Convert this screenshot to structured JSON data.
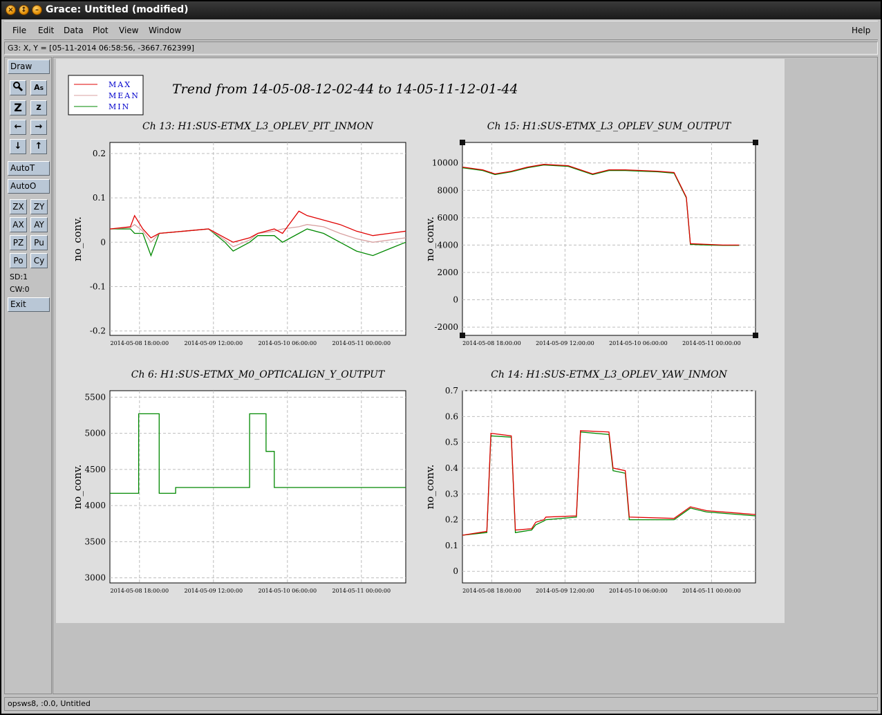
{
  "window": {
    "title": "Grace: Untitled (modified)"
  },
  "menubar": {
    "items": [
      "File",
      "Edit",
      "Data",
      "Plot",
      "View",
      "Window"
    ],
    "help": "Help"
  },
  "locator": {
    "text": "G3: X, Y = [05-11-2014 06:58:56, -3667.762399]"
  },
  "toolbar": {
    "draw": "Draw",
    "autot": "AutoT",
    "autoo": "AutoO",
    "zx": "ZX",
    "zy": "ZY",
    "ax": "AX",
    "ay": "AY",
    "pz": "PZ",
    "pu": "Pu",
    "po": "Po",
    "cy": "Cy",
    "sd": "SD:1",
    "cw": "CW:0",
    "exit": "Exit",
    "icons": [
      "zoom-icon",
      "text-icon",
      "autoscale-z-icon",
      "zoom-z-icon",
      "left-arrow-icon",
      "right-arrow-icon",
      "down-arrow-icon",
      "up-arrow-icon"
    ]
  },
  "statusbar": {
    "text": "opsws8, :0.0, Untitled"
  },
  "figure": {
    "title": "Trend from 14-05-08-12-02-44 to 14-05-11-12-01-44",
    "legend": [
      {
        "label": "MAX",
        "color": "#e00000"
      },
      {
        "label": "MEAN",
        "color": "#d8a0a0"
      },
      {
        "label": "MIN",
        "color": "#008800"
      }
    ]
  },
  "chart_data": [
    {
      "type": "line",
      "title": "Ch 13: H1:SUS-ETMX_L3_OPLEV_PIT_INMON",
      "ylabel": "no_conv.",
      "xlabel": "",
      "yticks": [
        "0.2",
        "0.1",
        "0",
        "-0.1",
        "-0.2"
      ],
      "xticks": [
        "2014-05-08 18:00:00",
        "2014-05-09 12:00:00",
        "2014-05-10 06:00:00",
        "2014-05-11 00:00:00"
      ],
      "ylim": [
        -0.21,
        0.225
      ],
      "grid": true,
      "series": [
        {
          "name": "MAX",
          "x_hours": [
            0,
            5,
            6,
            8,
            10,
            12,
            18,
            24,
            28,
            30,
            34,
            36,
            40,
            42,
            46,
            48,
            52,
            56,
            60,
            64,
            68,
            72
          ],
          "values": [
            0.03,
            0.035,
            0.06,
            0.03,
            0.01,
            0.02,
            0.025,
            0.03,
            0.01,
            0.0,
            0.01,
            0.02,
            0.03,
            0.02,
            0.07,
            0.06,
            0.05,
            0.04,
            0.025,
            0.015,
            0.02,
            0.025
          ]
        },
        {
          "name": "MEAN",
          "x_hours": [
            0,
            5,
            6,
            8,
            10,
            12,
            18,
            24,
            28,
            30,
            34,
            36,
            40,
            42,
            46,
            48,
            52,
            56,
            60,
            64,
            68,
            72
          ],
          "values": [
            0.03,
            0.033,
            0.04,
            0.025,
            0.0,
            0.02,
            0.025,
            0.03,
            0.005,
            -0.01,
            0.005,
            0.02,
            0.025,
            0.03,
            0.035,
            0.04,
            0.035,
            0.02,
            0.008,
            0.0,
            0.005,
            0.01
          ]
        },
        {
          "name": "MIN",
          "x_hours": [
            0,
            5,
            6,
            8,
            10,
            12,
            18,
            24,
            28,
            30,
            34,
            36,
            40,
            42,
            46,
            48,
            52,
            56,
            60,
            64,
            68,
            72
          ],
          "values": [
            0.03,
            0.03,
            0.02,
            0.02,
            -0.03,
            0.02,
            0.025,
            0.03,
            0.0,
            -0.02,
            0.0,
            0.015,
            0.015,
            0.0,
            0.02,
            0.03,
            0.02,
            0.0,
            -0.02,
            -0.03,
            -0.015,
            0.0
          ]
        }
      ]
    },
    {
      "type": "line",
      "title": "Ch 15: H1:SUS-ETMX_L3_OPLEV_SUM_OUTPUT",
      "ylabel": "no_conv.",
      "xlabel": "",
      "yticks": [
        "10000",
        "8000",
        "6000",
        "4000",
        "2000",
        "0",
        "-2000"
      ],
      "xticks": [
        "2014-05-08 18:00:00",
        "2014-05-09 12:00:00",
        "2014-05-10 06:00:00",
        "2014-05-11 00:00:00"
      ],
      "ylim": [
        -2600,
        11500
      ],
      "grid": true,
      "series": [
        {
          "name": "MAX",
          "x_hours": [
            0,
            5,
            8,
            12,
            16,
            20,
            26,
            32,
            36,
            40,
            44,
            48,
            52,
            55,
            56,
            60,
            64,
            68
          ],
          "values": [
            9700,
            9500,
            9200,
            9400,
            9700,
            9900,
            9800,
            9200,
            9500,
            9500,
            9450,
            9400,
            9300,
            7500,
            4100,
            4050,
            4000,
            4000
          ]
        },
        {
          "name": "MIN",
          "x_hours": [
            0,
            5,
            8,
            12,
            16,
            20,
            26,
            32,
            36,
            40,
            44,
            48,
            52,
            55,
            56,
            60,
            64,
            68
          ],
          "values": [
            9650,
            9450,
            9150,
            9350,
            9650,
            9850,
            9750,
            9150,
            9450,
            9450,
            9400,
            9350,
            9250,
            7450,
            4050,
            4000,
            3980,
            3980
          ]
        }
      ]
    },
    {
      "type": "line",
      "title": "Ch 6: H1:SUS-ETMX_M0_OPTICALIGN_Y_OUTPUT",
      "ylabel": "no_conv.",
      "xlabel": "",
      "yticks": [
        "5500",
        "5000",
        "4500",
        "4000",
        "3500",
        "3000"
      ],
      "xticks": [
        "2014-05-08 18:00:00",
        "2014-05-09 12:00:00",
        "2014-05-10 06:00:00",
        "2014-05-11 00:00:00"
      ],
      "ylim": [
        2930,
        5590
      ],
      "grid": true,
      "series": [
        {
          "name": "MIN",
          "x_hours": [
            0,
            7,
            7,
            12,
            12,
            16,
            16,
            21,
            21,
            25,
            25,
            34,
            34,
            38,
            38,
            40,
            40,
            72
          ],
          "values": [
            4170,
            4170,
            5270,
            5270,
            4170,
            4170,
            4250,
            4250,
            4250,
            4250,
            4250,
            4250,
            5270,
            5270,
            4750,
            4750,
            4250,
            4250
          ]
        }
      ]
    },
    {
      "type": "line",
      "title": "Ch 14: H1:SUS-ETMX_L3_OPLEV_YAW_INMON",
      "ylabel": "no_conv.",
      "xlabel": "",
      "yticks": [
        "0.7",
        "0.6",
        "0.5",
        "0.4",
        "0.3",
        "0.2",
        "0.1",
        "0"
      ],
      "xticks": [
        "2014-05-08 18:00:00",
        "2014-05-09 12:00:00",
        "2014-05-10 06:00:00",
        "2014-05-11 00:00:00"
      ],
      "ylim": [
        -0.045,
        0.7
      ],
      "grid": true,
      "series": [
        {
          "name": "MAX",
          "x_hours": [
            0,
            6,
            7,
            12,
            13,
            17,
            18,
            20,
            20.5,
            28,
            29,
            36,
            37,
            40,
            41,
            52,
            56,
            60,
            68,
            72
          ],
          "values": [
            0.14,
            0.155,
            0.535,
            0.525,
            0.16,
            0.165,
            0.19,
            0.2,
            0.21,
            0.215,
            0.545,
            0.54,
            0.4,
            0.39,
            0.21,
            0.205,
            0.25,
            0.235,
            0.225,
            0.22
          ]
        },
        {
          "name": "MIN",
          "x_hours": [
            0,
            6,
            7,
            12,
            13,
            17,
            18,
            20,
            20.5,
            28,
            29,
            36,
            37,
            40,
            41,
            52,
            56,
            60,
            68,
            72
          ],
          "values": [
            0.14,
            0.15,
            0.525,
            0.52,
            0.15,
            0.16,
            0.18,
            0.195,
            0.2,
            0.21,
            0.54,
            0.53,
            0.39,
            0.38,
            0.2,
            0.2,
            0.245,
            0.23,
            0.22,
            0.215
          ]
        }
      ]
    }
  ]
}
